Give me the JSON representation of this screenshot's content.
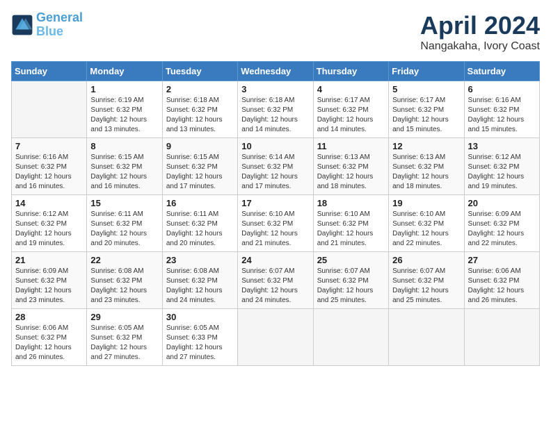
{
  "logo": {
    "line1": "General",
    "line2": "Blue"
  },
  "title": "April 2024",
  "location": "Nangakaha, Ivory Coast",
  "weekdays": [
    "Sunday",
    "Monday",
    "Tuesday",
    "Wednesday",
    "Thursday",
    "Friday",
    "Saturday"
  ],
  "weeks": [
    [
      {
        "day": "",
        "sunrise": "",
        "sunset": "",
        "daylight": ""
      },
      {
        "day": "1",
        "sunrise": "Sunrise: 6:19 AM",
        "sunset": "Sunset: 6:32 PM",
        "daylight": "Daylight: 12 hours and 13 minutes."
      },
      {
        "day": "2",
        "sunrise": "Sunrise: 6:18 AM",
        "sunset": "Sunset: 6:32 PM",
        "daylight": "Daylight: 12 hours and 13 minutes."
      },
      {
        "day": "3",
        "sunrise": "Sunrise: 6:18 AM",
        "sunset": "Sunset: 6:32 PM",
        "daylight": "Daylight: 12 hours and 14 minutes."
      },
      {
        "day": "4",
        "sunrise": "Sunrise: 6:17 AM",
        "sunset": "Sunset: 6:32 PM",
        "daylight": "Daylight: 12 hours and 14 minutes."
      },
      {
        "day": "5",
        "sunrise": "Sunrise: 6:17 AM",
        "sunset": "Sunset: 6:32 PM",
        "daylight": "Daylight: 12 hours and 15 minutes."
      },
      {
        "day": "6",
        "sunrise": "Sunrise: 6:16 AM",
        "sunset": "Sunset: 6:32 PM",
        "daylight": "Daylight: 12 hours and 15 minutes."
      }
    ],
    [
      {
        "day": "7",
        "sunrise": "Sunrise: 6:16 AM",
        "sunset": "Sunset: 6:32 PM",
        "daylight": "Daylight: 12 hours and 16 minutes."
      },
      {
        "day": "8",
        "sunrise": "Sunrise: 6:15 AM",
        "sunset": "Sunset: 6:32 PM",
        "daylight": "Daylight: 12 hours and 16 minutes."
      },
      {
        "day": "9",
        "sunrise": "Sunrise: 6:15 AM",
        "sunset": "Sunset: 6:32 PM",
        "daylight": "Daylight: 12 hours and 17 minutes."
      },
      {
        "day": "10",
        "sunrise": "Sunrise: 6:14 AM",
        "sunset": "Sunset: 6:32 PM",
        "daylight": "Daylight: 12 hours and 17 minutes."
      },
      {
        "day": "11",
        "sunrise": "Sunrise: 6:13 AM",
        "sunset": "Sunset: 6:32 PM",
        "daylight": "Daylight: 12 hours and 18 minutes."
      },
      {
        "day": "12",
        "sunrise": "Sunrise: 6:13 AM",
        "sunset": "Sunset: 6:32 PM",
        "daylight": "Daylight: 12 hours and 18 minutes."
      },
      {
        "day": "13",
        "sunrise": "Sunrise: 6:12 AM",
        "sunset": "Sunset: 6:32 PM",
        "daylight": "Daylight: 12 hours and 19 minutes."
      }
    ],
    [
      {
        "day": "14",
        "sunrise": "Sunrise: 6:12 AM",
        "sunset": "Sunset: 6:32 PM",
        "daylight": "Daylight: 12 hours and 19 minutes."
      },
      {
        "day": "15",
        "sunrise": "Sunrise: 6:11 AM",
        "sunset": "Sunset: 6:32 PM",
        "daylight": "Daylight: 12 hours and 20 minutes."
      },
      {
        "day": "16",
        "sunrise": "Sunrise: 6:11 AM",
        "sunset": "Sunset: 6:32 PM",
        "daylight": "Daylight: 12 hours and 20 minutes."
      },
      {
        "day": "17",
        "sunrise": "Sunrise: 6:10 AM",
        "sunset": "Sunset: 6:32 PM",
        "daylight": "Daylight: 12 hours and 21 minutes."
      },
      {
        "day": "18",
        "sunrise": "Sunrise: 6:10 AM",
        "sunset": "Sunset: 6:32 PM",
        "daylight": "Daylight: 12 hours and 21 minutes."
      },
      {
        "day": "19",
        "sunrise": "Sunrise: 6:10 AM",
        "sunset": "Sunset: 6:32 PM",
        "daylight": "Daylight: 12 hours and 22 minutes."
      },
      {
        "day": "20",
        "sunrise": "Sunrise: 6:09 AM",
        "sunset": "Sunset: 6:32 PM",
        "daylight": "Daylight: 12 hours and 22 minutes."
      }
    ],
    [
      {
        "day": "21",
        "sunrise": "Sunrise: 6:09 AM",
        "sunset": "Sunset: 6:32 PM",
        "daylight": "Daylight: 12 hours and 23 minutes."
      },
      {
        "day": "22",
        "sunrise": "Sunrise: 6:08 AM",
        "sunset": "Sunset: 6:32 PM",
        "daylight": "Daylight: 12 hours and 23 minutes."
      },
      {
        "day": "23",
        "sunrise": "Sunrise: 6:08 AM",
        "sunset": "Sunset: 6:32 PM",
        "daylight": "Daylight: 12 hours and 24 minutes."
      },
      {
        "day": "24",
        "sunrise": "Sunrise: 6:07 AM",
        "sunset": "Sunset: 6:32 PM",
        "daylight": "Daylight: 12 hours and 24 minutes."
      },
      {
        "day": "25",
        "sunrise": "Sunrise: 6:07 AM",
        "sunset": "Sunset: 6:32 PM",
        "daylight": "Daylight: 12 hours and 25 minutes."
      },
      {
        "day": "26",
        "sunrise": "Sunrise: 6:07 AM",
        "sunset": "Sunset: 6:32 PM",
        "daylight": "Daylight: 12 hours and 25 minutes."
      },
      {
        "day": "27",
        "sunrise": "Sunrise: 6:06 AM",
        "sunset": "Sunset: 6:32 PM",
        "daylight": "Daylight: 12 hours and 26 minutes."
      }
    ],
    [
      {
        "day": "28",
        "sunrise": "Sunrise: 6:06 AM",
        "sunset": "Sunset: 6:32 PM",
        "daylight": "Daylight: 12 hours and 26 minutes."
      },
      {
        "day": "29",
        "sunrise": "Sunrise: 6:05 AM",
        "sunset": "Sunset: 6:32 PM",
        "daylight": "Daylight: 12 hours and 27 minutes."
      },
      {
        "day": "30",
        "sunrise": "Sunrise: 6:05 AM",
        "sunset": "Sunset: 6:33 PM",
        "daylight": "Daylight: 12 hours and 27 minutes."
      },
      {
        "day": "",
        "sunrise": "",
        "sunset": "",
        "daylight": ""
      },
      {
        "day": "",
        "sunrise": "",
        "sunset": "",
        "daylight": ""
      },
      {
        "day": "",
        "sunrise": "",
        "sunset": "",
        "daylight": ""
      },
      {
        "day": "",
        "sunrise": "",
        "sunset": "",
        "daylight": ""
      }
    ]
  ]
}
